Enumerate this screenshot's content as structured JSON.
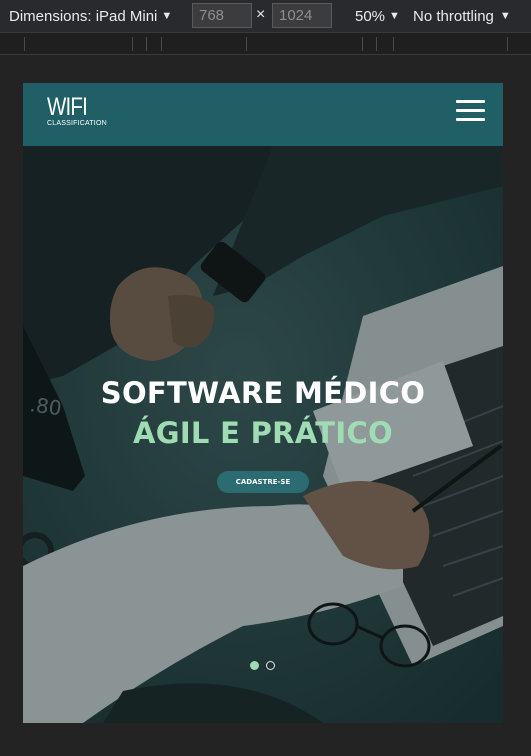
{
  "devtools": {
    "dimensions_label": "Dimensions: iPad Mini",
    "width_value": "768",
    "height_value": "1024",
    "times_symbol": "×",
    "zoom": "50%",
    "throttling": "No throttling"
  },
  "site": {
    "logo_main": "WIFI",
    "logo_sub": "CLASSIFICATION",
    "hero": {
      "headline_line1": "SOFTWARE MÉDICO",
      "headline_line2": "ÁGIL E PRÁTICO",
      "cta_label": "CADASTRE-SE",
      "slides_count": 2,
      "active_slide": 1
    }
  },
  "colors": {
    "navbar": "#215f66",
    "accent_green": "#9fdcb3",
    "button": "#2b6b72",
    "page_background": "#232323"
  }
}
